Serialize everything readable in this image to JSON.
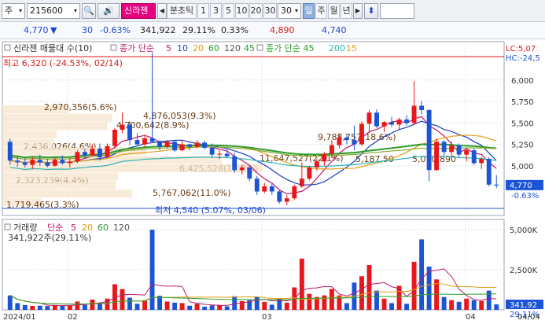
{
  "toolbar": {
    "market": "주",
    "code": "215600",
    "name": "신라젠",
    "nav_prev": "◀",
    "period_label": "분초틱",
    "periods": [
      "1",
      "3",
      "5",
      "10",
      "20",
      "30"
    ],
    "interval_value": "30",
    "range_tabs": [
      "일",
      "주",
      "월",
      "년"
    ],
    "nav_next": "▶",
    "count_value": "",
    "arrow": "⬍"
  },
  "quote": {
    "price": "4,770",
    "change_arrow": "▼",
    "change": "30",
    "change_pct": "-0.63%",
    "volume": "341,922",
    "vol_ratio": "29.11%",
    "turnover": "0.33%",
    "high": "4,890",
    "low": "4,740"
  },
  "price_panel": {
    "legend": {
      "title": "신라젠 매물대 수(10)",
      "ma_label": "종가 단순",
      "ma_periods": [
        "5",
        "10",
        "20",
        "60",
        "120",
        "45"
      ],
      "env_label": "종가 단순 45",
      "env_periods": [
        "200",
        "15"
      ]
    },
    "lc_label": "LC:5,07",
    "hc_label": "HC:-24,5",
    "max_note": "최고 6,320 (-24.53%, 02/14)",
    "min_note": "최저 4,540 (5.07%, 03/06)",
    "y_ticks": [
      "6,000",
      "5,750",
      "5,500",
      "5,250",
      "5,000"
    ],
    "price_tag": "4,770",
    "price_tag_pct": "-0.63%",
    "volume_profile": [
      {
        "label": "2,970,356(5.6%)",
        "weight": 0.56
      },
      {
        "label": "4,876,053(9.3%)",
        "weight": 0.93
      },
      {
        "label": "4,700,642(8.9%)",
        "weight": 0.89
      },
      {
        "label": "2,436,026(4.6%)",
        "weight": 0.46
      },
      {
        "label": "2,323,239(4.4%)",
        "weight": 0.44
      },
      {
        "label": "6,425,528(12.2%)",
        "weight": 1.22
      },
      {
        "label": "9,788,757(18.6%)",
        "weight": 1.86
      },
      {
        "label": "11,647,527(22.1%)",
        "weight": 2.21
      },
      {
        "label": "5,187,50",
        "weight": 0.98
      },
      {
        "label": "5,070,890",
        "weight": 0.96
      },
      {
        "label": "5,767,062(11.0%)",
        "weight": 1.1
      },
      {
        "label": "1,719,465(3.3%)",
        "weight": 0.33
      }
    ]
  },
  "volume_panel": {
    "legend": {
      "title": "거래량",
      "ma_label": "단순",
      "ma_periods": [
        "5",
        "20",
        "60",
        "120"
      ]
    },
    "current": "341,922주(29.11%)",
    "y_ticks": [
      "5,000K",
      "2,500K"
    ],
    "tag_vol": "341,92",
    "tag_pct": "29,11%"
  },
  "x_axis": {
    "labels": [
      "2024/01",
      "02",
      "03",
      "04",
      "04/04"
    ]
  },
  "colors": {
    "up": "#e8171b",
    "down": "#1c54d6",
    "ma5": "#c0196b",
    "ma10": "#1a3fbf",
    "ma20": "#e39c14",
    "ma60": "#2c9c2c",
    "ma120": "#88a82a",
    "env": "#29b4b6",
    "profile": "#f5e4cc"
  },
  "chart_data": {
    "type": "candlestick",
    "y_range": [
      4420,
      6420
    ],
    "volume_range": [
      0,
      5500000
    ],
    "candles": [
      {
        "o": 5280,
        "h": 5320,
        "l": 5010,
        "c": 5060,
        "v": 900000
      },
      {
        "o": 5060,
        "h": 5110,
        "l": 4990,
        "c": 5040,
        "v": 420000
      },
      {
        "o": 5040,
        "h": 5090,
        "l": 4980,
        "c": 5010,
        "v": 300000
      },
      {
        "o": 5010,
        "h": 5100,
        "l": 4960,
        "c": 5070,
        "v": 250000
      },
      {
        "o": 5070,
        "h": 5130,
        "l": 5000,
        "c": 5040,
        "v": 260000
      },
      {
        "o": 5040,
        "h": 5080,
        "l": 4980,
        "c": 5000,
        "v": 240000
      },
      {
        "o": 5000,
        "h": 5090,
        "l": 4990,
        "c": 5070,
        "v": 300000
      },
      {
        "o": 5070,
        "h": 5120,
        "l": 5010,
        "c": 5030,
        "v": 260000
      },
      {
        "o": 5030,
        "h": 5090,
        "l": 4980,
        "c": 5050,
        "v": 250000
      },
      {
        "o": 5050,
        "h": 5180,
        "l": 5030,
        "c": 5160,
        "v": 520000
      },
      {
        "o": 5160,
        "h": 5200,
        "l": 5080,
        "c": 5120,
        "v": 300000
      },
      {
        "o": 5120,
        "h": 5250,
        "l": 5110,
        "c": 5200,
        "v": 640000
      },
      {
        "o": 5200,
        "h": 5260,
        "l": 5060,
        "c": 5100,
        "v": 450000
      },
      {
        "o": 5100,
        "h": 5260,
        "l": 5090,
        "c": 5230,
        "v": 700000
      },
      {
        "o": 5230,
        "h": 5440,
        "l": 5200,
        "c": 5420,
        "v": 1600000
      },
      {
        "o": 5420,
        "h": 5620,
        "l": 5380,
        "c": 5480,
        "v": 1300000
      },
      {
        "o": 5480,
        "h": 5520,
        "l": 5240,
        "c": 5300,
        "v": 760000
      },
      {
        "o": 5300,
        "h": 5380,
        "l": 5230,
        "c": 5250,
        "v": 380000
      },
      {
        "o": 5250,
        "h": 5360,
        "l": 5220,
        "c": 5320,
        "v": 600000
      },
      {
        "o": 5320,
        "h": 6320,
        "l": 5280,
        "c": 5280,
        "v": 5000000
      },
      {
        "o": 5280,
        "h": 5300,
        "l": 5180,
        "c": 5220,
        "v": 880000
      },
      {
        "o": 5220,
        "h": 5300,
        "l": 5200,
        "c": 5280,
        "v": 520000
      },
      {
        "o": 5280,
        "h": 5290,
        "l": 5160,
        "c": 5180,
        "v": 450000
      },
      {
        "o": 5180,
        "h": 5290,
        "l": 5170,
        "c": 5250,
        "v": 420000
      },
      {
        "o": 5250,
        "h": 5260,
        "l": 5180,
        "c": 5220,
        "v": 260000
      },
      {
        "o": 5220,
        "h": 5300,
        "l": 5200,
        "c": 5270,
        "v": 380000
      },
      {
        "o": 5270,
        "h": 5290,
        "l": 5190,
        "c": 5210,
        "v": 200000
      },
      {
        "o": 5210,
        "h": 5260,
        "l": 5100,
        "c": 5130,
        "v": 280000
      },
      {
        "o": 5130,
        "h": 5180,
        "l": 5080,
        "c": 5140,
        "v": 300000
      },
      {
        "o": 5140,
        "h": 5190,
        "l": 5090,
        "c": 5110,
        "v": 220000
      },
      {
        "o": 5110,
        "h": 5150,
        "l": 4920,
        "c": 4950,
        "v": 850000
      },
      {
        "o": 4950,
        "h": 5010,
        "l": 4900,
        "c": 4980,
        "v": 550000
      },
      {
        "o": 4980,
        "h": 5000,
        "l": 4820,
        "c": 4850,
        "v": 600000
      },
      {
        "o": 4850,
        "h": 4880,
        "l": 4660,
        "c": 4700,
        "v": 820000
      },
      {
        "o": 4700,
        "h": 4800,
        "l": 4680,
        "c": 4760,
        "v": 500000
      },
      {
        "o": 4760,
        "h": 4790,
        "l": 4660,
        "c": 4700,
        "v": 320000
      },
      {
        "o": 4700,
        "h": 4720,
        "l": 4560,
        "c": 4580,
        "v": 700000
      },
      {
        "o": 4580,
        "h": 4660,
        "l": 4540,
        "c": 4620,
        "v": 450000
      },
      {
        "o": 4620,
        "h": 4780,
        "l": 4600,
        "c": 4760,
        "v": 1400000
      },
      {
        "o": 4760,
        "h": 5040,
        "l": 4740,
        "c": 4850,
        "v": 3200000
      },
      {
        "o": 4850,
        "h": 5000,
        "l": 4830,
        "c": 4980,
        "v": 1000000
      },
      {
        "o": 4980,
        "h": 5080,
        "l": 4940,
        "c": 5050,
        "v": 800000
      },
      {
        "o": 5050,
        "h": 5160,
        "l": 5000,
        "c": 5140,
        "v": 900000
      },
      {
        "o": 5140,
        "h": 5300,
        "l": 5090,
        "c": 5240,
        "v": 1300000
      },
      {
        "o": 5240,
        "h": 5380,
        "l": 5200,
        "c": 5330,
        "v": 900000
      },
      {
        "o": 5330,
        "h": 5360,
        "l": 5250,
        "c": 5300,
        "v": 420000
      },
      {
        "o": 5300,
        "h": 5470,
        "l": 5180,
        "c": 5250,
        "v": 1700000
      },
      {
        "o": 5250,
        "h": 5520,
        "l": 5230,
        "c": 5490,
        "v": 2100000
      },
      {
        "o": 5490,
        "h": 5650,
        "l": 5380,
        "c": 5620,
        "v": 2800000
      },
      {
        "o": 5620,
        "h": 5660,
        "l": 5440,
        "c": 5460,
        "v": 1200000
      },
      {
        "o": 5460,
        "h": 5520,
        "l": 5390,
        "c": 5510,
        "v": 700000
      },
      {
        "o": 5510,
        "h": 5570,
        "l": 5450,
        "c": 5480,
        "v": 420000
      },
      {
        "o": 5480,
        "h": 5560,
        "l": 5420,
        "c": 5540,
        "v": 1500000
      },
      {
        "o": 5540,
        "h": 5590,
        "l": 5470,
        "c": 5500,
        "v": 380000
      },
      {
        "o": 5500,
        "h": 5990,
        "l": 5470,
        "c": 5700,
        "v": 3000000
      },
      {
        "o": 5700,
        "h": 5760,
        "l": 5600,
        "c": 5650,
        "v": 4400000
      },
      {
        "o": 5650,
        "h": 5660,
        "l": 4820,
        "c": 4950,
        "v": 2700000
      },
      {
        "o": 4950,
        "h": 5320,
        "l": 4940,
        "c": 5280,
        "v": 1900000
      },
      {
        "o": 5280,
        "h": 5300,
        "l": 5120,
        "c": 5160,
        "v": 800000
      },
      {
        "o": 5160,
        "h": 5280,
        "l": 5100,
        "c": 5240,
        "v": 600000
      },
      {
        "o": 5240,
        "h": 5260,
        "l": 5100,
        "c": 5130,
        "v": 500000
      },
      {
        "o": 5130,
        "h": 5200,
        "l": 5050,
        "c": 5180,
        "v": 700000
      },
      {
        "o": 5180,
        "h": 5200,
        "l": 5010,
        "c": 5030,
        "v": 600000
      },
      {
        "o": 5030,
        "h": 5110,
        "l": 4960,
        "c": 5080,
        "v": 550000
      },
      {
        "o": 5080,
        "h": 5100,
        "l": 4760,
        "c": 4780,
        "v": 1200000
      },
      {
        "o": 4780,
        "h": 4890,
        "l": 4740,
        "c": 4770,
        "v": 341922
      }
    ]
  }
}
